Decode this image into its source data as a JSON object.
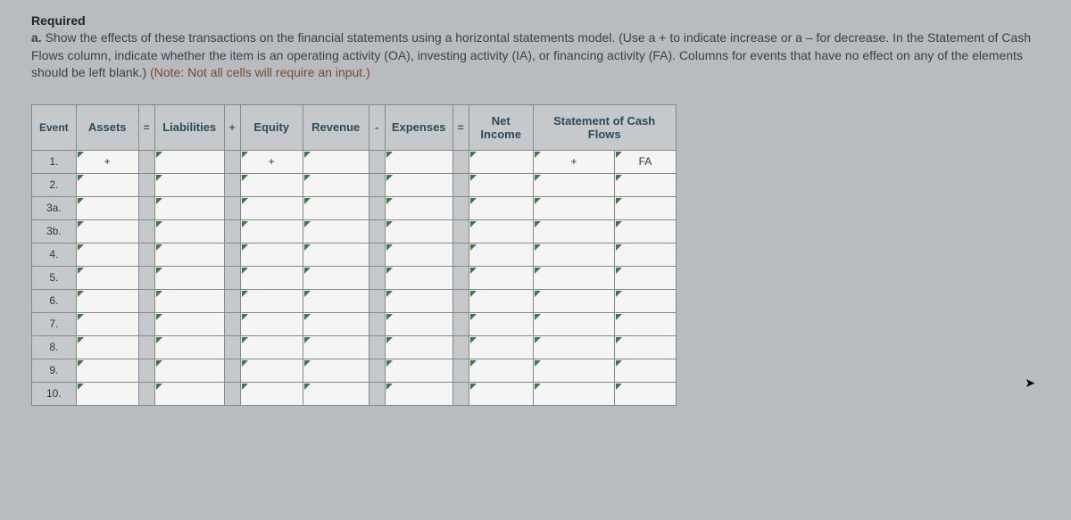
{
  "heading": "Required",
  "instruction_parts": {
    "prefix": "a. ",
    "main": "Show the effects of these transactions on the financial statements using a horizontal statements model. (Use a + to indicate increase or a – for decrease. In the Statement of Cash Flows column, indicate whether the item is an operating activity (OA), investing activity (IA), or financing activity (FA). Columns for events that have no effect on any of the elements should be left blank.) ",
    "note": "(Note: Not all cells will require an input.)"
  },
  "headers": {
    "event": "Event",
    "assets": "Assets",
    "eq1": "=",
    "liabilities": "Liabilities",
    "plus1": "+",
    "equity": "Equity",
    "revenue": "Revenue",
    "minus1": "-",
    "expenses": "Expenses",
    "eq2": "=",
    "net_income": "Net Income",
    "cash_flows": "Statement of Cash Flows"
  },
  "rows": [
    {
      "label": "1.",
      "assets": "+",
      "liabilities": "",
      "equity": "+",
      "revenue": "",
      "expenses": "",
      "net_income": "",
      "cash_amt": "+",
      "cash_type": "FA"
    },
    {
      "label": "2.",
      "assets": "",
      "liabilities": "",
      "equity": "",
      "revenue": "",
      "expenses": "",
      "net_income": "",
      "cash_amt": "",
      "cash_type": ""
    },
    {
      "label": "3a.",
      "assets": "",
      "liabilities": "",
      "equity": "",
      "revenue": "",
      "expenses": "",
      "net_income": "",
      "cash_amt": "",
      "cash_type": ""
    },
    {
      "label": "3b.",
      "assets": "",
      "liabilities": "",
      "equity": "",
      "revenue": "",
      "expenses": "",
      "net_income": "",
      "cash_amt": "",
      "cash_type": ""
    },
    {
      "label": "4.",
      "assets": "",
      "liabilities": "",
      "equity": "",
      "revenue": "",
      "expenses": "",
      "net_income": "",
      "cash_amt": "",
      "cash_type": ""
    },
    {
      "label": "5.",
      "assets": "",
      "liabilities": "",
      "equity": "",
      "revenue": "",
      "expenses": "",
      "net_income": "",
      "cash_amt": "",
      "cash_type": ""
    },
    {
      "label": "6.",
      "assets": "",
      "liabilities": "",
      "equity": "",
      "revenue": "",
      "expenses": "",
      "net_income": "",
      "cash_amt": "",
      "cash_type": ""
    },
    {
      "label": "7.",
      "assets": "",
      "liabilities": "",
      "equity": "",
      "revenue": "",
      "expenses": "",
      "net_income": "",
      "cash_amt": "",
      "cash_type": ""
    },
    {
      "label": "8.",
      "assets": "",
      "liabilities": "",
      "equity": "",
      "revenue": "",
      "expenses": "",
      "net_income": "",
      "cash_amt": "",
      "cash_type": ""
    },
    {
      "label": "9.",
      "assets": "",
      "liabilities": "",
      "equity": "",
      "revenue": "",
      "expenses": "",
      "net_income": "",
      "cash_amt": "",
      "cash_type": ""
    },
    {
      "label": "10.",
      "assets": "",
      "liabilities": "",
      "equity": "",
      "revenue": "",
      "expenses": "",
      "net_income": "",
      "cash_amt": "",
      "cash_type": ""
    }
  ]
}
